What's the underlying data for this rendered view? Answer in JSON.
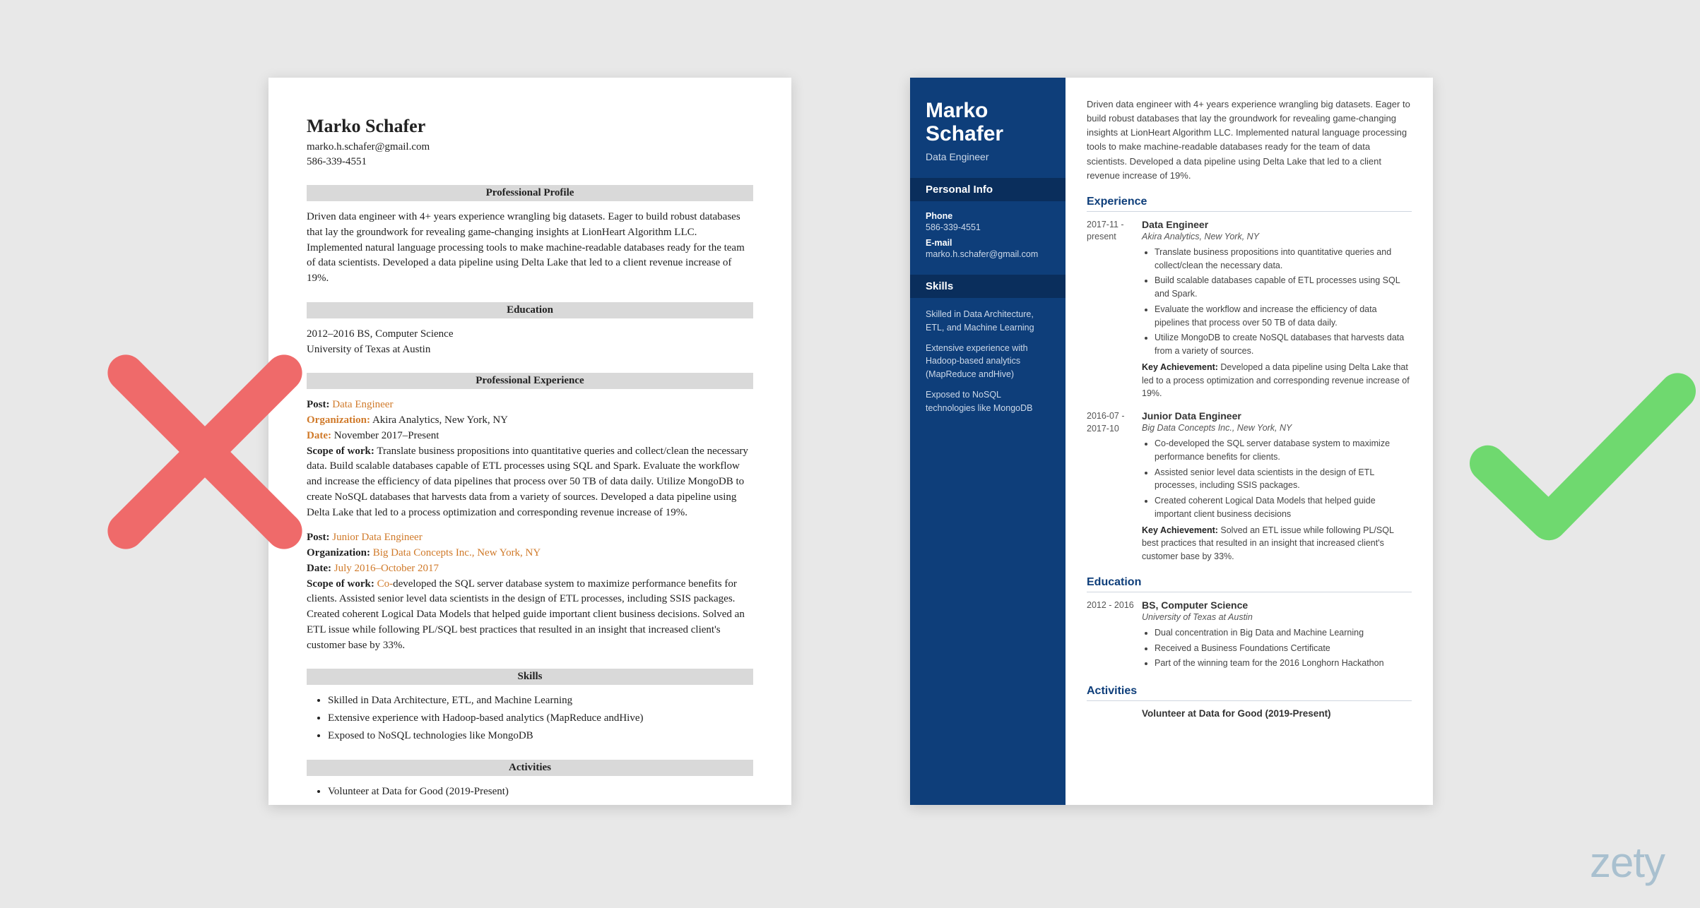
{
  "person": {
    "name": "Marko Schafer",
    "email": "marko.h.schafer@gmail.com",
    "phone": "586-339-4551",
    "role": "Data Engineer"
  },
  "summary": "Driven data engineer with 4+ years experience wrangling big datasets. Eager to build robust databases that lay the groundwork for revealing game-changing insights at LionHeart Algorithm LLC. Implemented natural language processing tools to make machine-readable databases ready for the team of data scientists. Developed a data pipeline using Delta Lake that led to a client revenue increase of 19%.",
  "left": {
    "headings": {
      "profile": "Professional Profile",
      "education": "Education",
      "experience": "Professional Experience",
      "skills": "Skills",
      "activities": "Activities"
    },
    "education": {
      "line1": "2012–2016 BS, Computer Science",
      "line2": "University of Texas at Austin"
    },
    "labels": {
      "post": "Post:",
      "org": "Organization:",
      "date": "Date:",
      "scope": "Scope of work:"
    },
    "job1": {
      "post": "Data Engineer",
      "org": "Akira Analytics, New York, NY",
      "date": "November 2017–Present",
      "scope": "Translate business propositions into quantitative queries and collect/clean the necessary data. Build scalable databases capable of ETL processes using SQL and Spark. Evaluate the workflow and increase the efficiency of data pipelines that process over 50 TB of data daily. Utilize MongoDB to create NoSQL databases that harvests data from a variety of sources. Developed a data pipeline using Delta Lake that led to a process optimization and corresponding revenue increase of 19%."
    },
    "job2": {
      "post": "Junior Data Engineer",
      "org": "Big Data Concepts Inc., New York, NY",
      "date": "July 2016–October 2017",
      "scope": "Co-developed the SQL server database system to maximize performance benefits for clients. Assisted senior level data scientists in the design of ETL processes, including SSIS packages. Created coherent Logical Data Models that helped guide important client business decisions. Solved an ETL issue while following PL/SQL best practices that resulted in an insight that increased client's customer base by 33%."
    },
    "skills": [
      "Skilled in Data Architecture, ETL, and Machine Learning",
      "Extensive experience with Hadoop-based analytics (MapReduce andHive)",
      "Exposed to NoSQL technologies like MongoDB"
    ],
    "activities": [
      "Volunteer at Data for Good (2019-Present)"
    ]
  },
  "right": {
    "sidebar": {
      "personal_info_head": "Personal Info",
      "phone_label": "Phone",
      "email_label": "E-mail",
      "skills_head": "Skills",
      "skills": [
        "Skilled in Data Architecture, ETL, and Machine Learning",
        "Extensive experience with Hadoop-based analytics (MapReduce andHive)",
        "Exposed to NoSQL technologies like MongoDB"
      ]
    },
    "sections": {
      "experience": "Experience",
      "education": "Education",
      "activities": "Activities"
    },
    "exp1": {
      "date": "2017-11 - present",
      "title": "Data Engineer",
      "company": "Akira Analytics, New York, NY",
      "bullets": [
        "Translate business propositions into quantitative queries and collect/clean the necessary data.",
        "Build scalable databases capable of ETL processes using SQL and Spark.",
        "Evaluate the workflow and increase the efficiency of data pipelines that process over 50 TB of data daily.",
        "Utilize MongoDB to create NoSQL databases that harvests data from a variety of sources."
      ],
      "key_label": "Key Achievement:",
      "key_text": " Developed a data pipeline using Delta Lake that led to a process optimization and corresponding revenue increase of 19%."
    },
    "exp2": {
      "date": "2016-07 - 2017-10",
      "title": "Junior Data Engineer",
      "company": "Big Data Concepts Inc., New York, NY",
      "bullets": [
        "Co-developed the SQL server database system to maximize performance benefits for clients.",
        "Assisted senior level data scientists in the design of ETL processes, including SSIS packages.",
        "Created coherent Logical Data Models that helped guide important client business decisions"
      ],
      "key_label": "Key Achievement:",
      "key_text": " Solved an ETL issue while following PL/SQL best practices that resulted in an insight that increased client's customer base by 33%."
    },
    "edu": {
      "date": "2012 - 2016",
      "title": "BS, Computer Science",
      "school": "University of Texas at Austin",
      "bullets": [
        "Dual concentration in Big Data and Machine Learning",
        "Received a Business Foundations Certificate",
        "Part of the winning team for the 2016 Longhorn Hackathon"
      ]
    },
    "activity": "Volunteer at Data for Good (2019-Present)"
  },
  "watermark": "zety"
}
